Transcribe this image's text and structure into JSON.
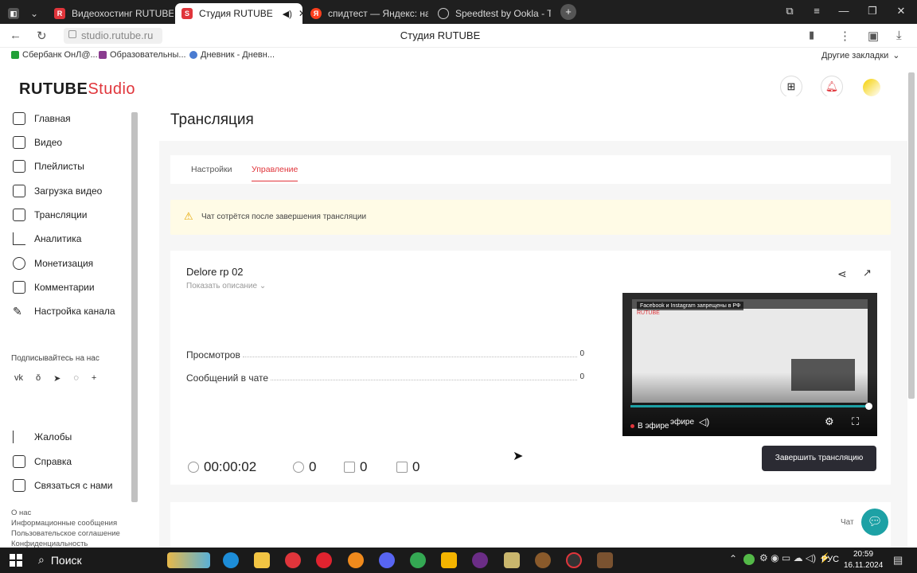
{
  "browser": {
    "tabs": [
      {
        "title": "Видеохостинг RUTUBE. С",
        "color": "#e0353b",
        "letter": "R"
      },
      {
        "title": "Студия RUTUBE",
        "color": "#e0353b",
        "letter": "S",
        "active": true,
        "audio_icon": "speaker-icon"
      },
      {
        "title": "спидтест — Яндекс: нашл",
        "color": "#fc3f1d",
        "letter": "Я"
      },
      {
        "title": "Speedtest by Ookla - The",
        "color": "#333",
        "letter": "◎"
      }
    ],
    "url": "studio.rutube.ru",
    "page_title": "Студия RUTUBE",
    "bookmarks": [
      "Сбербанк ОнЛ@...",
      "Образовательны...",
      "Дневник - Дневн..."
    ],
    "other_bookmarks": "Другие закладки"
  },
  "app": {
    "logo_rutube": "RUTUBE",
    "logo_studio": "Studio",
    "nav": [
      "Главная",
      "Видео",
      "Плейлисты",
      "Загрузка видео",
      "Трансляции",
      "Аналитика",
      "Монетизация",
      "Комментарии",
      "Настройка канала"
    ],
    "subscribe_label": "Подписывайтесь на нас",
    "social": [
      "vk",
      "ok",
      "telegram",
      "viber",
      "plus"
    ],
    "secondary_nav": [
      "Жалобы",
      "Справка",
      "Связаться с нами"
    ],
    "footer_links": [
      "О нас",
      "Информационные сообщения",
      "Пользовательское соглашение",
      "Конфиденциальность"
    ]
  },
  "main": {
    "page_title": "Трансляция",
    "tabs": [
      "Настройки",
      "Управление"
    ],
    "active_tab": "Управление",
    "notice": "Чат сотрётся после завершения трансляции",
    "stream": {
      "title": "Delore rp 02",
      "show_description": "Показать описание",
      "views_label": "Просмотров",
      "views_value": "0",
      "chat_label": "Сообщений в чате",
      "chat_value": "0",
      "duration": "00:00:02",
      "viewers": "0",
      "likes": "0",
      "dislikes": "0",
      "end_button": "Завершить трансляцию",
      "player_banner": "Facebook и Instagram запрещены в РФ",
      "live_label": "В эфире",
      "live_label_secondary": "эфире",
      "progress": 1.0
    },
    "chat_label": "Чат"
  },
  "taskbar": {
    "search": "Поиск",
    "time": "20:59",
    "date": "16.11.2024",
    "lang": "РУС"
  },
  "colors": {
    "accent": "#e0353b",
    "notice_bg": "#fffbe6",
    "teal": "#1da1a5",
    "dark_button": "#2b2b33"
  }
}
